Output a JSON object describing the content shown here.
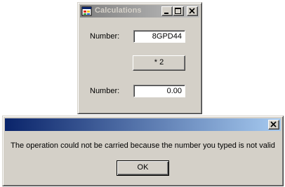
{
  "calc_window": {
    "title": "Calculations",
    "number_label": "Number:",
    "input_value": "8GPD44",
    "multiply_button": "* 2",
    "result_label": "Number:",
    "result_value": "0.00"
  },
  "message_box": {
    "title": "",
    "message": "The operation could not be carried because the number you typed is not valid",
    "ok_button": "OK"
  },
  "colors": {
    "inactive_title_start": "#808080",
    "inactive_title_end": "#c0c0c0",
    "active_title_start": "#0a246a",
    "active_title_end": "#a6caf0",
    "window_face": "#d4d0c8"
  },
  "icons": {
    "app": "app-icon",
    "minimize": "minimize-icon",
    "maximize": "maximize-icon",
    "close": "close-icon"
  }
}
